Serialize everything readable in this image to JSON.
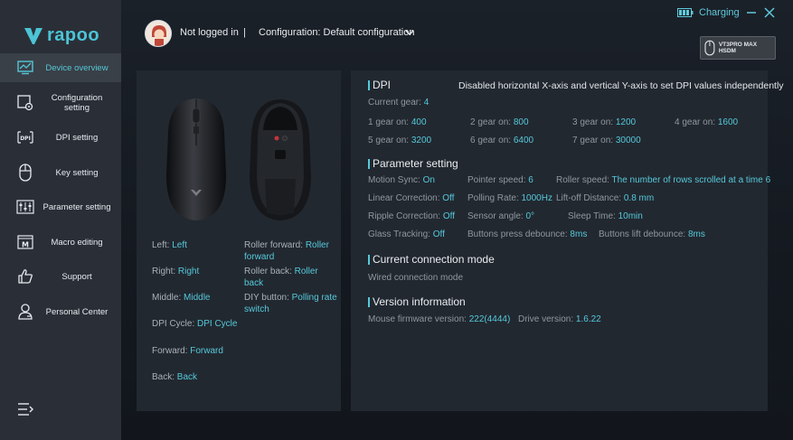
{
  "brand": {
    "name": "rapoo",
    "accent": "#55c9da"
  },
  "header": {
    "login_status": "Not logged in",
    "separator": "|",
    "configuration": "Configuration: Default configuration",
    "charging": "Charging",
    "device": "VT3PRO MAX HSDM"
  },
  "sidebar": {
    "items": [
      {
        "label": "Device overview",
        "icon": "monitor-icon",
        "active": true
      },
      {
        "label": "Configuration setting",
        "icon": "config-gear-icon"
      },
      {
        "label": "DPI setting",
        "icon": "dpi-icon"
      },
      {
        "label": "Key setting",
        "icon": "mouse-icon"
      },
      {
        "label": "Parameter setting",
        "icon": "sliders-icon"
      },
      {
        "label": "Macro editing",
        "icon": "macro-icon"
      },
      {
        "label": "Support",
        "icon": "thumbs-up-icon"
      },
      {
        "label": "Personal Center",
        "icon": "user-icon"
      }
    ]
  },
  "buttons": {
    "left": {
      "label": "Left:",
      "value": "Left"
    },
    "right": {
      "label": "Right:",
      "value": "Right"
    },
    "middle": {
      "label": "Middle:",
      "value": "Middle"
    },
    "dpi": {
      "label": "DPI Cycle:",
      "value": "DPI Cycle"
    },
    "forward": {
      "label": "Forward:",
      "value": "Forward"
    },
    "back": {
      "label": "Back:",
      "value": "Back"
    },
    "roller_forward": {
      "label": "Roller forward:",
      "value": "Roller forward"
    },
    "roller_back": {
      "label": "Roller back:",
      "value": "Roller back"
    },
    "diy": {
      "label": "DIY button:",
      "value": "Polling rate switch"
    }
  },
  "dpi": {
    "title": "DPI",
    "note": "Disabled horizontal X-axis and vertical Y-axis to set DPI values independently",
    "current_label": "Current gear:",
    "current_value": "4",
    "gears": [
      {
        "label": "1 gear on:",
        "value": "400"
      },
      {
        "label": "2 gear on:",
        "value": "800"
      },
      {
        "label": "3 gear on:",
        "value": "1200"
      },
      {
        "label": "4 gear on:",
        "value": "1600"
      },
      {
        "label": "5 gear on:",
        "value": "3200"
      },
      {
        "label": "6 gear on:",
        "value": "6400"
      },
      {
        "label": "7 gear on:",
        "value": "30000"
      }
    ]
  },
  "params": {
    "title": "Parameter setting",
    "motion_sync": {
      "label": "Motion Sync:",
      "value": "On"
    },
    "pointer_speed": {
      "label": "Pointer speed:",
      "value": "6"
    },
    "roller_speed": {
      "label": "Roller speed:",
      "value": "The number of rows scrolled at a time 6"
    },
    "linear": {
      "label": "Linear Correction:",
      "value": "Off"
    },
    "polling": {
      "label": "Polling Rate:",
      "value": "1000Hz"
    },
    "liftoff": {
      "label": "Lift-off Distance:",
      "value": "0.8 mm"
    },
    "ripple": {
      "label": "Ripple Correction:",
      "value": "Off"
    },
    "angle": {
      "label": "Sensor angle:",
      "value": "0°"
    },
    "sleep": {
      "label": "Sleep Time:",
      "value": "10min"
    },
    "glass": {
      "label": "Glass Tracking:",
      "value": "Off"
    },
    "press_debounce": {
      "label": "Buttons press debounce:",
      "value": "8ms"
    },
    "lift_debounce": {
      "label": "Buttons lift debounce:",
      "value": "8ms"
    }
  },
  "connection": {
    "title": "Current connection mode",
    "value": "Wired connection mode"
  },
  "version": {
    "title": "Version information",
    "firmware_label": "Mouse firmware version:",
    "firmware_value": "222(4444)",
    "driver_label": "Drive version:",
    "driver_value": "1.6.22"
  }
}
